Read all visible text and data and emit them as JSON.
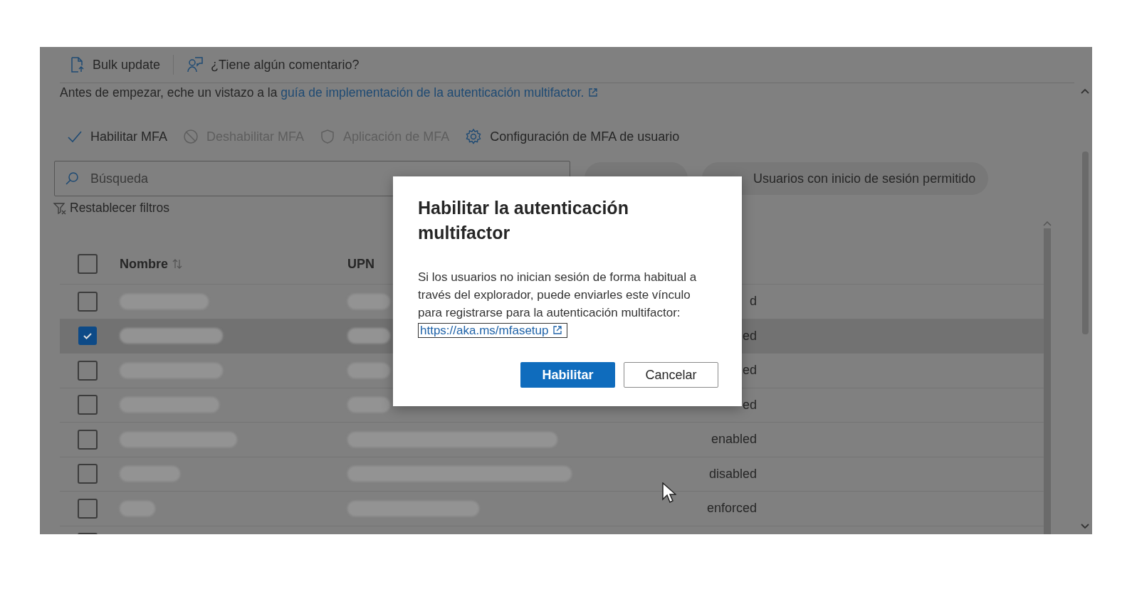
{
  "toolbar": {
    "items": [
      {
        "kind": "bulk",
        "label": "Bulk update"
      },
      {
        "kind": "feedback",
        "label": "¿Tiene algún comentario?"
      }
    ]
  },
  "info": {
    "text": "Antes de empezar, eche un vistazo a la ",
    "link": "guía de implementación de la autenticación multifactor."
  },
  "actions": [
    {
      "kind": "check",
      "label": "Habilitar MFA",
      "disabled": false
    },
    {
      "kind": "block",
      "label": "Deshabilitar MFA",
      "disabled": true
    },
    {
      "kind": "shield",
      "label": "Aplicación de MFA",
      "disabled": true
    },
    {
      "kind": "gear",
      "label": "Configuración de MFA de usuario",
      "disabled": false
    }
  ],
  "search": {
    "placeholder": "Búsqueda"
  },
  "filters": [
    {
      "kind": "obscured"
    },
    {
      "kind": "text",
      "label": "Usuarios con inicio de sesión permitido"
    }
  ],
  "reset_filters": "Restablecer filtros",
  "table": {
    "header_checked": false,
    "columns": [
      {
        "label": "Nombre",
        "sortable": true
      },
      {
        "label": "UPN",
        "sortable": false
      }
    ],
    "rows": [
      {
        "checked": false,
        "status": "d"
      },
      {
        "checked": true,
        "status": "ed"
      },
      {
        "checked": false,
        "status": "ed"
      },
      {
        "checked": false,
        "status": "ed"
      },
      {
        "checked": false,
        "status": "enabled"
      },
      {
        "checked": false,
        "status": "disabled"
      },
      {
        "checked": false,
        "status": "enforced"
      },
      {
        "checked": false
      }
    ]
  },
  "dialog": {
    "title": "Habilitar la autenticación multifactor",
    "body": "Si los usuarios no inician sesión de forma habitual a través del explorador, puede enviarles este vínculo para registrarse para la autenticación multifactor: ",
    "link": "https://aka.ms/mfasetup",
    "buttons": [
      {
        "kind": "primary",
        "label": "Habilitar"
      },
      {
        "kind": "secondary",
        "label": "Cancelar"
      }
    ]
  }
}
